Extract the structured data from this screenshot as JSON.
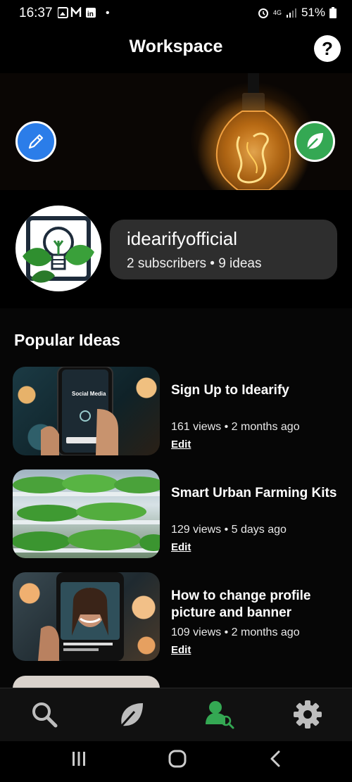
{
  "status": {
    "time": "16:37",
    "network": "4G",
    "battery": "51%"
  },
  "header": {
    "title": "Workspace",
    "help_label": "?"
  },
  "profile": {
    "name": "idearifyofficial",
    "subtitle": "2 subscribers • 9 ideas"
  },
  "section": {
    "title": "Popular Ideas"
  },
  "ideas": [
    {
      "title": "Sign Up to Idearify",
      "meta": "161 views • 2 months ago",
      "edit": "Edit",
      "thumb_text": "Social Media"
    },
    {
      "title": "Smart Urban Farming Kits",
      "meta": "129 views • 5 days ago",
      "edit": "Edit"
    },
    {
      "title": "How to change profile picture and banner",
      "meta": "109 views • 2 months ago",
      "edit": "Edit"
    }
  ],
  "nav": [
    "search-icon",
    "leaf-icon",
    "profile-search-icon",
    "gear-icon"
  ],
  "colors": {
    "accent_blue": "#2b7de9",
    "accent_green": "#34a853",
    "nav_active": "#34a853",
    "card": "#2e2e2e"
  }
}
